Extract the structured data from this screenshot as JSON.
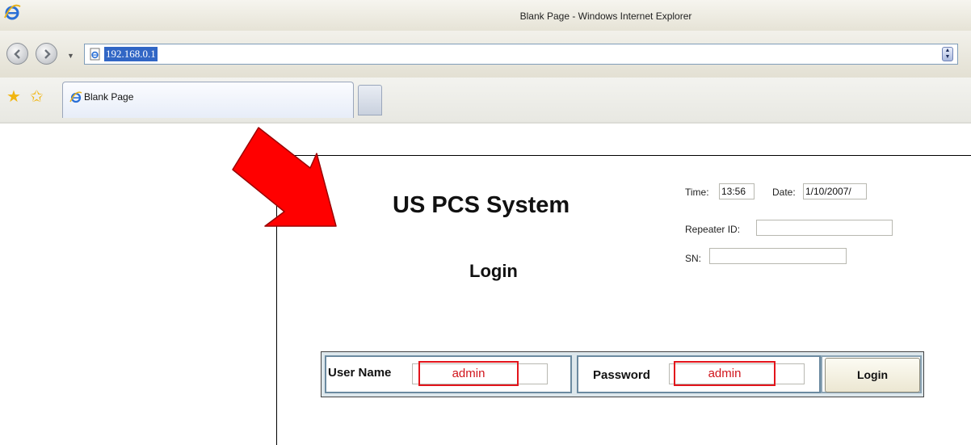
{
  "window": {
    "title": "Blank Page - Windows Internet Explorer"
  },
  "address_bar": {
    "url": "192.168.0.1"
  },
  "tabs": [
    {
      "label": "Blank Page"
    }
  ],
  "page": {
    "title": "US PCS System",
    "login_heading": "Login",
    "info": {
      "time_label": "Time:",
      "time_value": "13:56",
      "date_label": "Date:",
      "date_value": "1/10/2007/",
      "repeater_label": "Repeater ID:",
      "repeater_value": "",
      "sn_label": "SN:",
      "sn_value": ""
    },
    "form": {
      "username_label": "User Name",
      "username_value": "admin",
      "password_label": "Password",
      "password_value": "admin",
      "login_button": "Login"
    }
  },
  "colors": {
    "highlight_red": "#e3141b",
    "arrow_red": "#ff0000",
    "url_selection": "#3166c5"
  },
  "icons": [
    "ie-logo-icon",
    "back-icon",
    "forward-icon",
    "dropdown-icon",
    "page-icon",
    "favorites-star-icon",
    "add-favorites-icon",
    "red-pointer-arrow"
  ]
}
